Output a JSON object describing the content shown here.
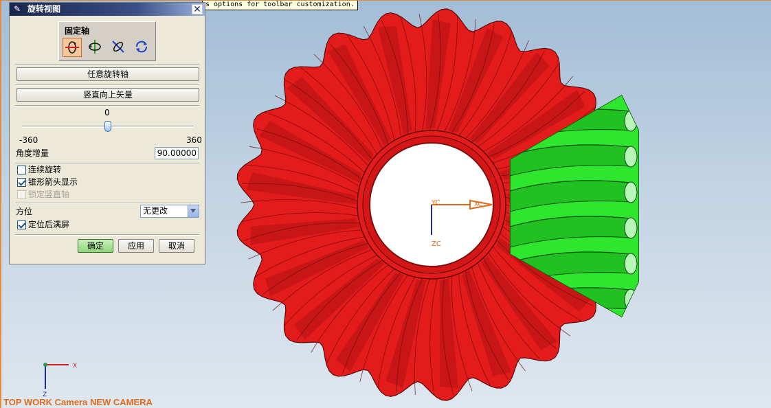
{
  "tooltip": {
    "text": "s options for toolbar customization."
  },
  "dialog": {
    "title": "旋转视图",
    "close_glyph": "✕",
    "fixed_axis_group": {
      "label": "固定轴",
      "icons": [
        "rotate-x-axis-icon",
        "rotate-y-axis-icon",
        "rotate-z-axis-icon",
        "free-rotate-icon"
      ],
      "selected_index": 0
    },
    "arbitrary_axis_button": "任意旋转轴",
    "vertical_up_button": "竖直向上矢量",
    "slider": {
      "value_label": "0",
      "min_label": "-360",
      "max_label": "360",
      "value": 0,
      "min": -360,
      "max": 360
    },
    "angle_increment": {
      "label": "角度增量",
      "value": "90.00000"
    },
    "options": {
      "continuous_rotate": {
        "label": "连续旋转",
        "checked": false
      },
      "cone_arrow_display": {
        "label": "锥形箭头显示",
        "checked": true
      },
      "lock_vertical_axis": {
        "label": "锁定竖直轴",
        "checked": false,
        "disabled": true
      }
    },
    "orientation": {
      "label": "方位",
      "value": "无更改"
    },
    "fit_after_orient": {
      "label": "定位后满屏",
      "checked": true
    },
    "buttons": {
      "ok": "确定",
      "apply": "应用",
      "cancel": "取消"
    }
  },
  "viewport": {
    "gear_colors": {
      "large_gear": "#e41b1b",
      "pinion": "#2ee62e"
    },
    "triad_center": {
      "x_label": "XC",
      "y_label": "YC",
      "z_label": "ZC",
      "color": "#e06b1a"
    },
    "triad_corner": {
      "x_label": "X",
      "z_label": "Z"
    },
    "camera_label": "TOP WORK Camera NEW  CAMERA"
  },
  "colors": {
    "accent": "#e06b1a",
    "title_bar": "#19254d",
    "dialog_bg": "#ece9d8"
  }
}
